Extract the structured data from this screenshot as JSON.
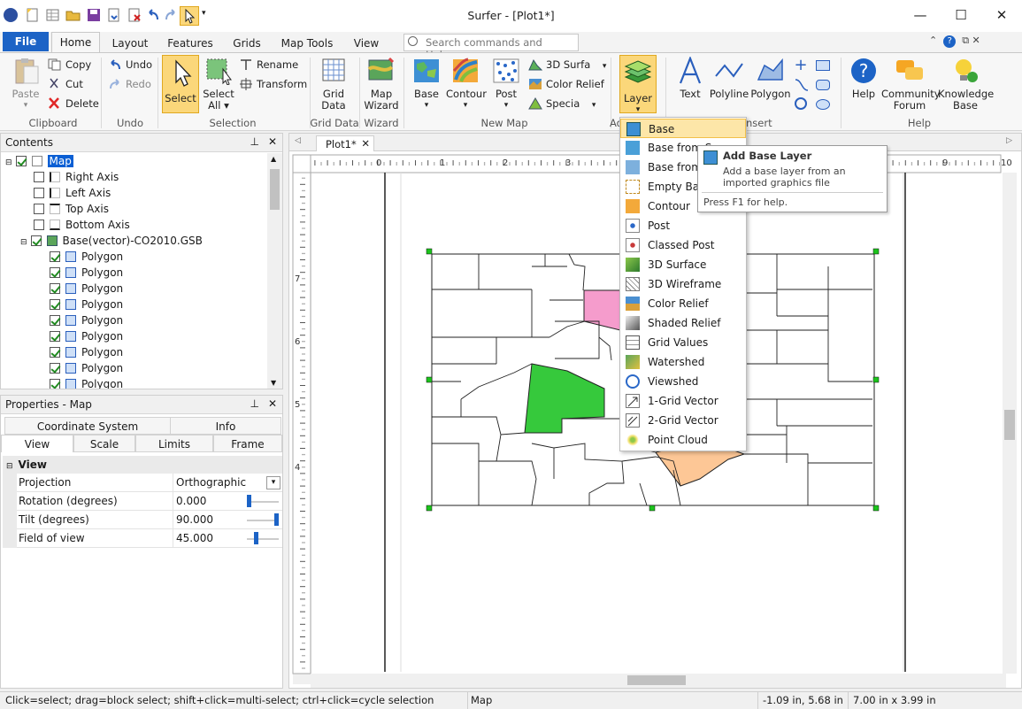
{
  "window": {
    "title": "Surfer - [Plot1*]",
    "min": "—",
    "max": "☐",
    "close": "✕"
  },
  "ribbon_tabs": [
    "File",
    "Home",
    "Layout",
    "Features",
    "Grids",
    "Map Tools",
    "View"
  ],
  "search": {
    "placeholder": "Search commands and Help..."
  },
  "clipboard": {
    "paste": "Paste",
    "copy": "Copy",
    "cut": "Cut",
    "delete": "Delete",
    "label": "Clipboard"
  },
  "undo": {
    "undo": "Undo",
    "redo": "Redo",
    "label": "Undo"
  },
  "selection": {
    "select": "Select",
    "select_all": "Select All",
    "rename": "Rename",
    "transform": "Transform",
    "label": "Selection"
  },
  "griddata": {
    "grid_data": "Grid Data",
    "label": "Grid Data"
  },
  "wizard": {
    "map_wizard": "Map Wizard",
    "label": "Wizard"
  },
  "newmap": {
    "base": "Base",
    "contour": "Contour",
    "post": "Post",
    "surface": "3D Surfa",
    "color_relief": "Color Relief",
    "specialty": "Specia",
    "label": "New Map"
  },
  "add": {
    "layer": "Layer",
    "label": "Ad"
  },
  "insert": {
    "text": "Text",
    "polyline": "Polyline",
    "polygon": "Polygon",
    "label": "nsert"
  },
  "help": {
    "help": "Help",
    "community": "Community Forum",
    "knowledge": "Knowledge Base",
    "label": "Help"
  },
  "contents": {
    "title": "Contents",
    "map": "Map",
    "axes": [
      "Right Axis",
      "Left Axis",
      "Top Axis",
      "Bottom Axis"
    ],
    "base_layer": "Base(vector)-CO2010.GSB",
    "polygons": [
      "Polygon",
      "Polygon",
      "Polygon",
      "Polygon",
      "Polygon",
      "Polygon",
      "Polygon",
      "Polygon",
      "Polygon"
    ]
  },
  "properties": {
    "title": "Properties - Map",
    "tabs_top": [
      "Coordinate System",
      "Info"
    ],
    "tabs_bottom": [
      "View",
      "Scale",
      "Limits",
      "Frame"
    ],
    "section": "View",
    "rows": [
      {
        "label": "Projection",
        "value": "Orthographic"
      },
      {
        "label": "Rotation (degrees)",
        "value": "0.000"
      },
      {
        "label": "Tilt (degrees)",
        "value": "90.000"
      },
      {
        "label": "Field of view",
        "value": "45.000"
      }
    ]
  },
  "doc": {
    "tab": "Plot1*"
  },
  "ruler": {
    "h": [
      "0",
      "1",
      "2",
      "3",
      "4",
      "5",
      "6",
      "7",
      "8",
      "9",
      "10"
    ],
    "v": [
      "7",
      "6",
      "5",
      "4"
    ]
  },
  "layer_menu": [
    "Base",
    "Base from S",
    "Base from D",
    "Empty Base",
    "Contour",
    "Post",
    "Classed Post",
    "3D Surface",
    "3D Wireframe",
    "Color Relief",
    "Shaded Relief",
    "Grid Values",
    "Watershed",
    "Viewshed",
    "1-Grid Vector",
    "2-Grid Vector",
    "Point Cloud"
  ],
  "tooltip": {
    "title": "Add Base Layer",
    "desc": "Add a base layer from an imported graphics file",
    "help": "Press F1 for help."
  },
  "status": {
    "hint": "Click=select; drag=block select; shift+click=multi-select; ctrl+click=cycle selection",
    "object": "Map",
    "coords": "-1.09 in, 5.68 in",
    "size": "7.00 in x 3.99 in"
  },
  "colors": {
    "accent": "#1c63c6",
    "selected_btn": "#fbd77a",
    "pink": "#f59ccc",
    "green": "#36c93c",
    "peach": "#fdc796"
  }
}
